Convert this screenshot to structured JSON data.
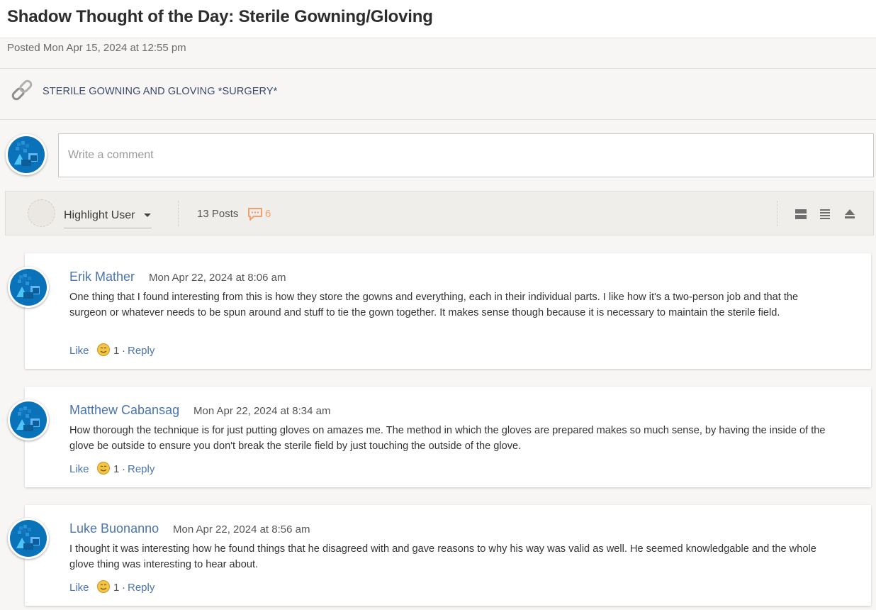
{
  "post": {
    "title": "Shadow Thought of the Day: Sterile Gowning/Gloving",
    "posted": "Posted Mon Apr 15, 2024 at 12:55 pm",
    "link_text": "STERILE GOWNING AND GLOVING *SURGERY*",
    "link_icon": "chain-link-icon"
  },
  "composer": {
    "placeholder": "Write a comment"
  },
  "toolbar": {
    "highlight_label": "Highlight User",
    "posts_count": "13 Posts",
    "unread_count": "6",
    "unread_color": "#f0a070",
    "view_icons": [
      "expanded-view-icon",
      "list-view-icon",
      "collapse-all-icon"
    ]
  },
  "colors": {
    "link_blue": "#4a74b4",
    "avatar_blue": "#0a72b8",
    "background": "#f7f6f4"
  },
  "comments": [
    {
      "author": "Erik Mather",
      "date": "Mon Apr 22, 2024 at 8:06 am",
      "text": "One thing that I found interesting from this is how they store the gowns and everything, each in their individual parts. I like how it's a two-person job and that the surgeon or whatever needs to be spun around and stuff to tie the gown together. It makes sense though because it is necessary to maintain the sterile field.",
      "like_label": "Like",
      "reaction_count": "1",
      "separator": "·",
      "reply_label": "Reply"
    },
    {
      "author": "Matthew Cabansag",
      "date": "Mon Apr 22, 2024 at 8:34 am",
      "text": "How thorough the technique is for just putting gloves on amazes me. The method in which the gloves are prepared makes so much sense, by having the inside of the glove be outside to ensure you don't break the sterile field by just touching the outside of the glove.",
      "like_label": "Like",
      "reaction_count": "1",
      "separator": "·",
      "reply_label": "Reply"
    },
    {
      "author": "Luke Buonanno",
      "date": "Mon Apr 22, 2024 at 8:56 am",
      "text": "I thought it was interesting how he found things that he disagreed with and gave reasons to why his way was valid as well. He seemed knowledgable and the whole glove thing was interesting to hear about.",
      "like_label": "Like",
      "reaction_count": "1",
      "separator": "·",
      "reply_label": "Reply"
    }
  ]
}
